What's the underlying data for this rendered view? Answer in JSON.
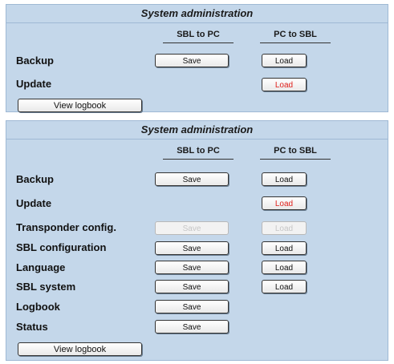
{
  "panels": [
    {
      "title": "System administration",
      "col_sbl_to_pc": "SBL to PC",
      "col_pc_to_sbl": "PC to SBL",
      "rows": [
        {
          "label": "Backup",
          "save": "Save",
          "load": "Load"
        },
        {
          "label": "Update",
          "load": "Load"
        }
      ],
      "logbook_button": "View logbook"
    },
    {
      "title": "System administration",
      "col_sbl_to_pc": "SBL to PC",
      "col_pc_to_sbl": "PC to SBL",
      "rows": [
        {
          "label": "Backup",
          "save": "Save",
          "load": "Load"
        },
        {
          "label": "Update",
          "load": "Load"
        },
        {
          "label": "Transponder config.",
          "save": "Save",
          "load": "Load"
        },
        {
          "label": "SBL configuration",
          "save": "Save",
          "load": "Load"
        },
        {
          "label": "Language",
          "save": "Save",
          "load": "Load"
        },
        {
          "label": "SBL system",
          "save": "Save",
          "load": "Load"
        },
        {
          "label": "Logbook",
          "save": "Save"
        },
        {
          "label": "Status",
          "save": "Save"
        }
      ],
      "logbook_button": "View logbook"
    }
  ],
  "colors": {
    "panel_bg": "#c4d7ea",
    "warning_text": "#e0201b",
    "disabled_text": "#c6c6c6"
  }
}
